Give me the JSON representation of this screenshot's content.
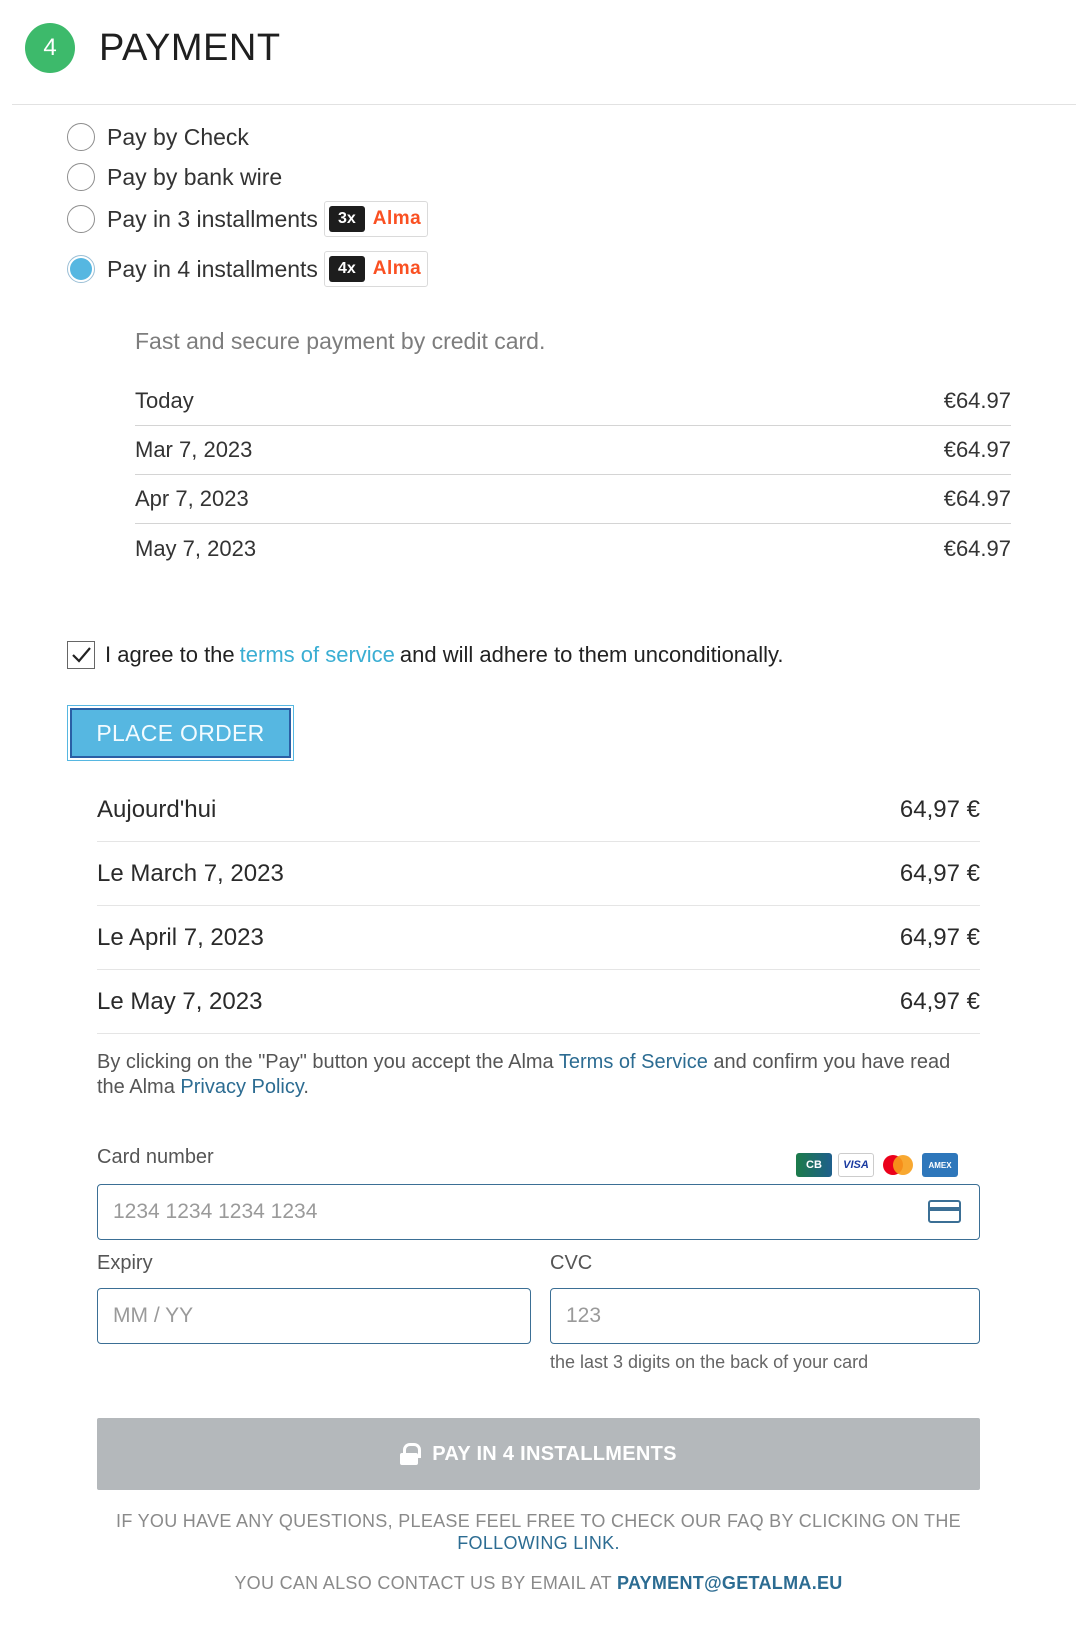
{
  "header": {
    "step_number": "4",
    "title": "PAYMENT"
  },
  "payment_options": [
    {
      "label": "Pay by Check",
      "selected": false
    },
    {
      "label": "Pay by bank wire",
      "selected": false
    },
    {
      "label": "Pay in 3 installments",
      "badge_count": "3x",
      "badge_brand": "Alma",
      "selected": false
    },
    {
      "label": "Pay in 4 installments",
      "badge_count": "4x",
      "badge_brand": "Alma",
      "selected": true
    }
  ],
  "installments": {
    "description": "Fast and secure payment by credit card.",
    "schedule": [
      {
        "date": "Today",
        "amount": "€64.97"
      },
      {
        "date": "Mar 7, 2023",
        "amount": "€64.97"
      },
      {
        "date": "Apr 7, 2023",
        "amount": "€64.97"
      },
      {
        "date": "May 7, 2023",
        "amount": "€64.97"
      }
    ]
  },
  "terms": {
    "checked": true,
    "prefix": "I agree to the",
    "link": "terms of service",
    "suffix": "and will adhere to them unconditionally."
  },
  "place_order_label": "PLACE ORDER",
  "alma": {
    "schedule": [
      {
        "date": "Aujourd'hui",
        "amount": "64,97 €"
      },
      {
        "date": "Le March 7, 2023",
        "amount": "64,97 €"
      },
      {
        "date": "Le April 7, 2023",
        "amount": "64,97 €"
      },
      {
        "date": "Le May 7, 2023",
        "amount": "64,97 €"
      }
    ],
    "legal": {
      "part1": "By clicking on the \"Pay\" button you accept the Alma",
      "tos_link": "Terms of Service",
      "part2": "and confirm you have read the Alma",
      "privacy_link": "Privacy Policy",
      "part3": "."
    },
    "card_form": {
      "card_number_label": "Card number",
      "card_number_placeholder": "1234 1234 1234 1234",
      "card_logos": {
        "cb": "CB",
        "visa": "VISA",
        "amex": "AMEX"
      },
      "expiry_label": "Expiry",
      "expiry_placeholder": "MM / YY",
      "cvc_label": "CVC",
      "cvc_placeholder": "123",
      "cvc_help": "the last 3 digits on the back of your card"
    },
    "pay_button_label": "PAY IN 4 INSTALLMENTS",
    "faq": {
      "text": "IF YOU HAVE ANY QUESTIONS, PLEASE FEEL FREE TO CHECK OUR FAQ BY CLICKING ON THE",
      "link": "FOLLOWING LINK."
    },
    "contact": {
      "text": "YOU CAN ALSO CONTACT US BY EMAIL AT",
      "email": "PAYMENT@GETALMA.EU"
    }
  },
  "colors": {
    "step_badge": "#3dba6b",
    "accent": "#56b7e1",
    "alma_brand": "#fa5022",
    "link": "#2c6c92",
    "pay_button_disabled": "#b4b8bb"
  }
}
